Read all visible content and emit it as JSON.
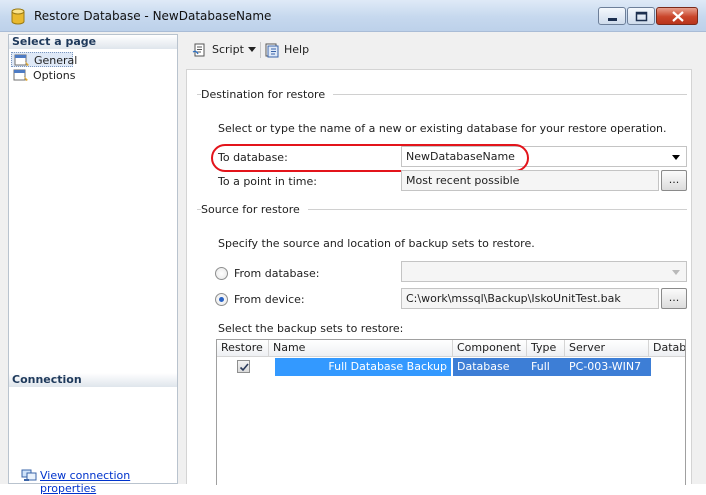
{
  "window": {
    "title": "Restore Database - NewDatabaseName"
  },
  "left_pane": {
    "select_page_header": "Select a page",
    "pages": [
      {
        "label": "General",
        "selected": true
      },
      {
        "label": "Options",
        "selected": false
      }
    ],
    "connection_header": "Connection",
    "view_connection_link": "View connection properties"
  },
  "toolbar": {
    "script_label": "Script",
    "help_label": "Help"
  },
  "destination": {
    "section_title": "Destination for restore",
    "instruction": "Select or type the name of a new or existing database for your restore operation.",
    "to_database_label": "To database:",
    "to_database_value": "NewDatabaseName",
    "point_in_time_label": "To a point in time:",
    "point_in_time_value": "Most recent possible",
    "ellipsis": "..."
  },
  "source": {
    "section_title": "Source for restore",
    "instruction": "Specify the source and location of backup sets to restore.",
    "from_database_label": "From database:",
    "from_database_value": "",
    "from_device_label": "From device:",
    "from_device_value": "C:\\work\\mssql\\Backup\\IskoUnitTest.bak",
    "ellipsis": "...",
    "selected_option": "From device",
    "backup_sets_label": "Select the backup sets to restore:"
  },
  "backup_grid": {
    "columns": [
      "Restore",
      "Name",
      "Component",
      "Type",
      "Server",
      "Databa"
    ],
    "rows": [
      {
        "restore": true,
        "name": "Full Database Backup",
        "component": "Database",
        "type": "Full",
        "server": "PC-003-WIN7",
        "database": ""
      }
    ]
  },
  "colors": {
    "highlight": "#e3141b",
    "selection": "#3399ff",
    "link": "#0033cc"
  }
}
